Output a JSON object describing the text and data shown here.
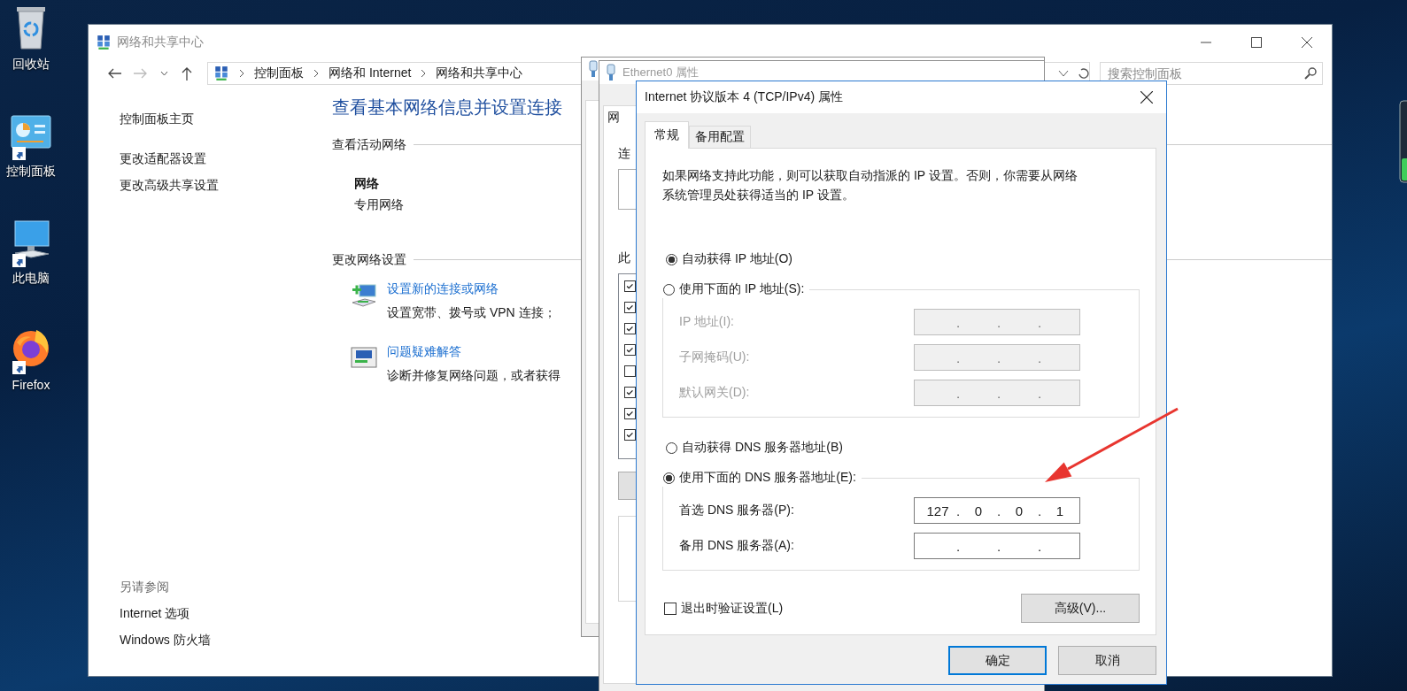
{
  "desktop_icons": [
    {
      "label": "回收站",
      "kind": "recycle-bin",
      "shortcut": false
    },
    {
      "label": "控制面板",
      "kind": "control-panel",
      "shortcut": true
    },
    {
      "label": "此电脑",
      "kind": "computer",
      "shortcut": true
    },
    {
      "label": "Firefox",
      "kind": "browser",
      "shortcut": true
    }
  ],
  "main_window": {
    "title": "网络和共享中心",
    "breadcrumb": [
      "控制面板",
      "网络和 Internet",
      "网络和共享中心"
    ],
    "search": {
      "placeholder": "搜索控制面板"
    },
    "sidebar": {
      "items": [
        "控制面板主页",
        "更改适配器设置",
        "更改高级共享设置"
      ],
      "see_also_title": "另请参阅",
      "see_also": [
        "Internet 选项",
        "Windows 防火墙"
      ]
    },
    "heading": "查看基本网络信息并设置连接",
    "active_networks": {
      "title": "查看活动网络",
      "network_name": "网络",
      "network_type": "专用网络"
    },
    "change_settings": {
      "title": "更改网络设置",
      "tasks": [
        {
          "kind": "new-connection",
          "link": "设置新的连接或网络",
          "description": "设置宽带、拨号或 VPN 连接；"
        },
        {
          "kind": "troubleshoot",
          "link": "问题疑难解答",
          "description": "诊断并修复网络问题，或者获得"
        }
      ]
    }
  },
  "ethernet_window": {
    "title": "Ethernet0 属性",
    "tab": "网",
    "labels": [
      "连",
      "此"
    ],
    "components": [
      {
        "checked": true
      },
      {
        "checked": true
      },
      {
        "checked": true
      },
      {
        "checked": true
      },
      {
        "checked": false
      },
      {
        "checked": true
      },
      {
        "checked": true
      },
      {
        "checked": true
      }
    ]
  },
  "ipv4_dialog": {
    "title": "Internet 协议版本 4 (TCP/IPv4) 属性",
    "tabs": [
      {
        "label": "常规",
        "selected": true
      },
      {
        "label": "备用配置",
        "selected": false
      }
    ],
    "description": [
      "如果网络支持此功能，则可以获取自动指派的 IP 设置。否则，你需要从网络",
      "系统管理员处获得适当的 IP 设置。"
    ],
    "ip_options": [
      {
        "label": "自动获得 IP 地址(O)",
        "selected": true
      },
      {
        "label": "使用下面的 IP 地址(S):",
        "selected": false
      }
    ],
    "ip_fields": [
      {
        "label": "IP 地址(I):",
        "disabled": true,
        "separators": [
          ".",
          ".",
          "."
        ]
      },
      {
        "label": "子网掩码(U):",
        "disabled": true,
        "separators": [
          ".",
          ".",
          "."
        ]
      },
      {
        "label": "默认网关(D):",
        "disabled": true,
        "separators": [
          ".",
          ".",
          "."
        ]
      }
    ],
    "dns_options": [
      {
        "label": "自动获得 DNS 服务器地址(B)",
        "selected": false
      },
      {
        "label": "使用下面的 DNS 服务器地址(E):",
        "selected": true
      }
    ],
    "dns_fields": [
      {
        "label": "首选 DNS 服务器(P):",
        "disabled": false,
        "octets": [
          "127",
          "0",
          "0",
          "1"
        ],
        "separators": [
          ".",
          ".",
          "."
        ]
      },
      {
        "label": "备用 DNS 服务器(A):",
        "disabled": false,
        "separators": [
          ".",
          ".",
          "."
        ]
      }
    ],
    "validate_on_exit": {
      "label": "退出时验证设置(L)",
      "checked": false
    },
    "advanced_button": "高级(V)...",
    "buttons": [
      {
        "label": "确定",
        "default": true
      },
      {
        "label": "取消",
        "default": false
      }
    ]
  }
}
